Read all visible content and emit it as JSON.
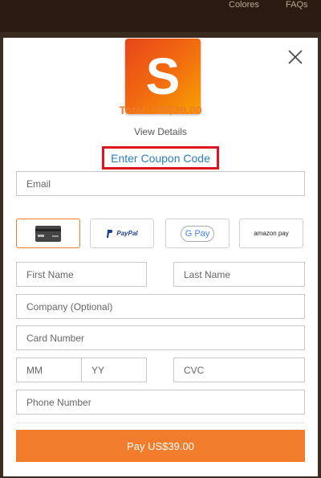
{
  "background": {
    "nav_left": "Colores",
    "nav_right": "FAQs"
  },
  "logo": {
    "letter": "S",
    "colors": [
      "#e8451a",
      "#f7a000"
    ]
  },
  "summary": {
    "total": "Total: US$39.00",
    "view_details": "View Details",
    "coupon": "Enter Coupon Code"
  },
  "form": {
    "email_placeholder": "Email",
    "first_name_placeholder": "First Name",
    "last_name_placeholder": "Last Name",
    "company_placeholder": "Company (Optional)",
    "card_number_placeholder": "Card Number",
    "mm_placeholder": "MM",
    "yy_placeholder": "YY",
    "cvc_placeholder": "CVC",
    "phone_placeholder": "Phone Number"
  },
  "payment_methods": {
    "selected": "card",
    "paypal_label": "PayPal",
    "gpay_label": "G Pay",
    "amazon_label": "amazon pay"
  },
  "pay_button": {
    "label": "Pay US$39.00"
  },
  "colors": {
    "accent": "#f07c2c",
    "coupon_highlight": "#e0141e",
    "link": "#2a7fc1"
  }
}
